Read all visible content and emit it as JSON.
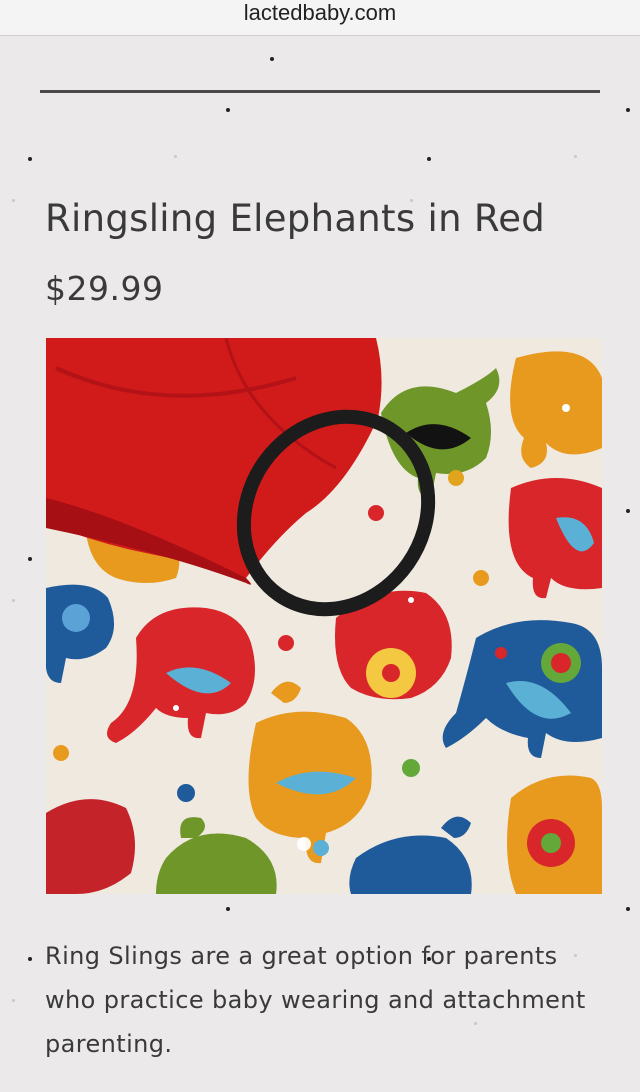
{
  "browser": {
    "url": "lactedbaby.com"
  },
  "product": {
    "title": "Ringsling Elephants in Red",
    "price": "$29.99",
    "image_alt_icon": "product-photo",
    "description": "Ring Slings are a great option for parents who practice baby wearing and attachment parenting."
  },
  "colors": {
    "background": "#ebe9ea",
    "text": "#3a3a3a",
    "sling_red": "#d11a1a",
    "ring_black": "#1c1c1c"
  }
}
